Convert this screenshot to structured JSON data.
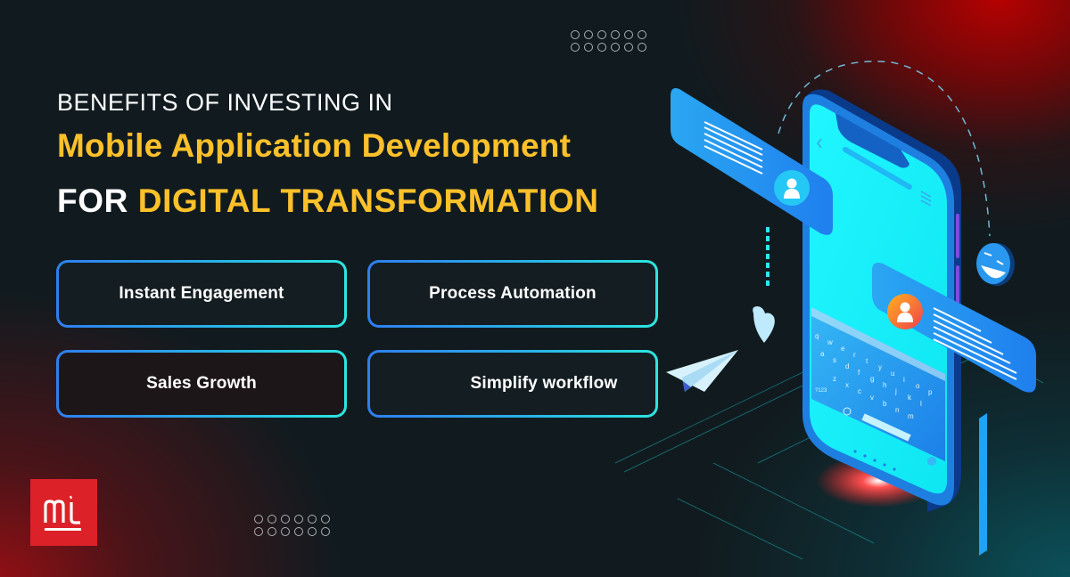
{
  "header": {
    "line1": "BENEFITS OF INVESTING IN",
    "line2": "Mobile Application Development",
    "line3_prefix": "FOR",
    "line3_highlight": "DIGITAL TRANSFORMATION"
  },
  "benefits": [
    {
      "label": "Instant Engagement"
    },
    {
      "label": "Process Automation"
    },
    {
      "label": "Sales Growth"
    },
    {
      "label": "Simplify workflow"
    }
  ],
  "logo": {
    "text": "mt",
    "color": "#dc2128"
  },
  "colors": {
    "background": "#111b1f",
    "accent_yellow": "#fcc12a",
    "card_border_start": "#2f7ef0",
    "card_border_end": "#2ce6e0",
    "phone_screen": "#12f0f5",
    "phone_body": "#1e7fe0"
  },
  "illustration": {
    "description": "isometric smartphone with chat bubbles",
    "keyboard_rows": [
      "qwertyuiop",
      "asdfghjkl",
      "zxcvbnm"
    ],
    "keyboard_numeric_key": "?123",
    "icons": [
      "user-avatar-icon",
      "emoji-face-icon",
      "heart-icon",
      "paper-plane-icon"
    ]
  }
}
